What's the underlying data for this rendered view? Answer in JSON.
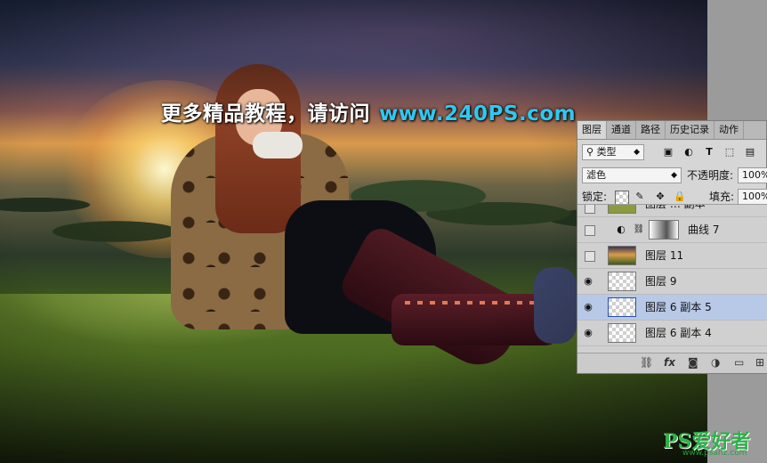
{
  "watermark": {
    "text": "更多精品教程，请访问",
    "url": "www.240PS.com"
  },
  "panel": {
    "tabs": [
      "图层",
      "通道",
      "路径",
      "历史记录",
      "动作"
    ],
    "filter_type": "类型",
    "filter_icons": [
      "image-filter-icon",
      "adjustment-filter-icon",
      "text-filter-icon",
      "shape-filter-icon",
      "smart-object-filter-icon"
    ],
    "filter_text_glyph": "T",
    "blend_mode": "滤色",
    "opacity_label": "不透明度:",
    "opacity_value": "100%",
    "lock_label": "锁定:",
    "fill_label": "填充:",
    "fill_value": "100%",
    "layers": [
      {
        "name": "图层 … 副本",
        "visible": false,
        "type": "partial"
      },
      {
        "name": "曲线 7",
        "visible": false,
        "type": "adjustment"
      },
      {
        "name": "图层 11",
        "visible": false,
        "type": "photo"
      },
      {
        "name": "图层 9",
        "visible": true,
        "type": "checker"
      },
      {
        "name": "图层 6 副本 5",
        "visible": true,
        "type": "checker",
        "selected": true
      },
      {
        "name": "图层 6 副本 4",
        "visible": true,
        "type": "checker"
      }
    ],
    "footer_icons": [
      "link-icon",
      "fx-icon",
      "mask-icon",
      "adjustment-icon",
      "folder-icon",
      "new-layer-icon"
    ],
    "fx_text": "fx"
  },
  "logo": {
    "text": "PS爱好者",
    "subtext": "www.psahz.com"
  },
  "colors": {
    "url": "#30c8f0",
    "selected_layer": "#b7c9e6",
    "logo": "#2fb14a"
  }
}
